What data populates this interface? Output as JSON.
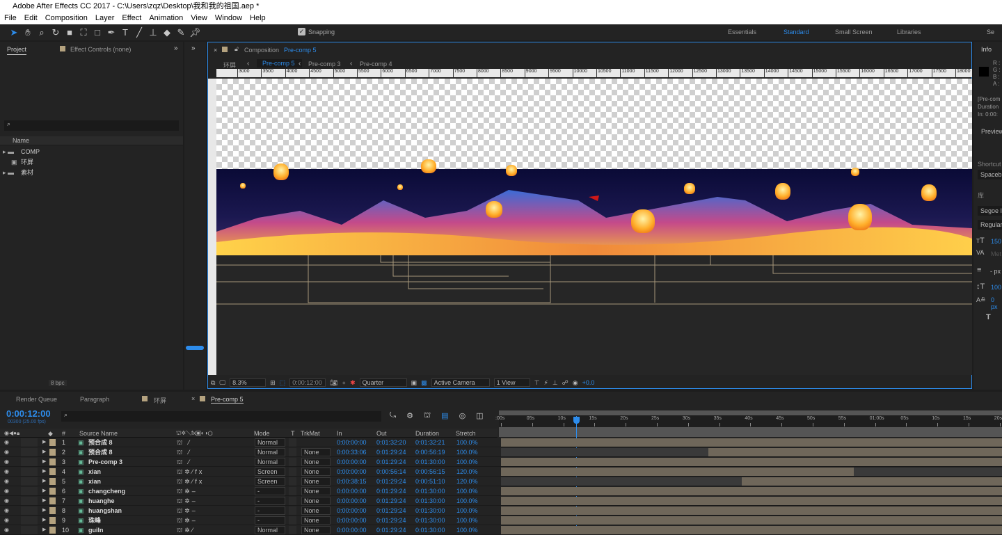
{
  "window": {
    "title": "Adobe After Effects CC 2017 - C:\\Users\\zqz\\Desktop\\我和我的祖国.aep *",
    "logo": "Ae"
  },
  "menu": [
    "File",
    "Edit",
    "Composition",
    "Layer",
    "Effect",
    "Animation",
    "View",
    "Window",
    "Help"
  ],
  "toolbar": {
    "tools": [
      "selection-icon",
      "hand-icon",
      "zoom-icon",
      "rotate-icon",
      "camera-icon",
      "pan-behind-icon",
      "rectangle-icon",
      "pen-icon",
      "type-icon",
      "brush-icon",
      "clone-stamp-icon",
      "eraser-icon",
      "roto-brush-icon",
      "puppet-pin-icon"
    ],
    "snapping": "Snapping",
    "workspaces": [
      "Essentials",
      "Standard",
      "Small Screen",
      "Libraries"
    ],
    "active_workspace": "Standard",
    "search": "Se"
  },
  "project": {
    "tab": "Project",
    "effect_tab": "Effect Controls (none)",
    "column_name": "Name",
    "items": [
      {
        "name": "COMP",
        "type": "folder"
      },
      {
        "name": "环屏",
        "type": "comp"
      },
      {
        "name": "素材",
        "type": "folder"
      }
    ],
    "bpc": "8 bpc"
  },
  "composition": {
    "tab_prefix": "Composition",
    "tab_name": "Pre-comp 5",
    "breadcrumbs": [
      "环屏",
      "Pre-comp 5",
      "Pre-comp 3",
      "Pre-comp 4"
    ],
    "active_breadcrumb": "Pre-comp 5",
    "ruler": [
      "3000",
      "3500",
      "4000",
      "4500",
      "5000",
      "5500",
      "6000",
      "6500",
      "7000",
      "7500",
      "8000",
      "8500",
      "9000",
      "9500",
      "10000",
      "10500",
      "11000",
      "11500",
      "12000",
      "12500",
      "13000",
      "13500",
      "14000",
      "14500",
      "15000",
      "15500",
      "16000",
      "16500",
      "17000",
      "17500",
      "18000"
    ],
    "zoom": "8.3%",
    "timecode": "0:00:12:00",
    "resolution": "Quarter",
    "camera": "Active Camera",
    "views": "1 View",
    "exposure": "+0.0"
  },
  "info": {
    "tab": "Info",
    "channels": [
      "R :",
      "G :",
      "B :",
      "A :"
    ],
    "lines": [
      "[Pre-com",
      "Duration",
      "In: 0:00:"
    ],
    "preview": "Preview",
    "shortcut": "Shortcut",
    "shortcut_value": "Spaceb",
    "library": "库",
    "font": "Segoe I",
    "style": "Regular",
    "size": "150",
    "kerning": "Met",
    "stroke": "- px",
    "leading": "100",
    "baseline": "0 px"
  },
  "bottom_tabs": {
    "render_queue": "Render Queue",
    "paragraph": "Paragraph",
    "comp1": "环屏",
    "comp2": "Pre-comp 5"
  },
  "timeline": {
    "timecode": "0:00:12:00",
    "frames": "00300 (25.00 fps)",
    "headers": {
      "source": "Source Name",
      "mode": "Mode",
      "t": "T",
      "trkmat": "TrkMat",
      "in": "In",
      "out": "Out",
      "duration": "Duration",
      "stretch": "Stretch",
      "num": "#"
    },
    "ticks": [
      ":00s",
      "05s",
      "10s",
      "15s",
      "20s",
      "25s",
      "30s",
      "35s",
      "40s",
      "45s",
      "50s",
      "55s",
      "01:00s",
      "05s",
      "10s",
      "15s",
      "20s"
    ],
    "playhead_seconds": 12,
    "layers": [
      {
        "n": "1",
        "name": "预合成 8",
        "mode": "Normal",
        "trkmat": "",
        "in": "0:00:00:00",
        "out": "0:01:32:20",
        "dur": "0:01:32:21",
        "stretch": "100.0%",
        "fx": false,
        "start": 0,
        "end": null
      },
      {
        "n": "2",
        "name": "预合成 8",
        "mode": "Normal",
        "trkmat": "None",
        "in": "0:00:33:06",
        "out": "0:01:29:24",
        "dur": "0:00:56:19",
        "stretch": "100.0%",
        "fx": false,
        "start": 33.24,
        "end": null
      },
      {
        "n": "3",
        "name": "Pre-comp 3",
        "mode": "Normal",
        "trkmat": "None",
        "in": "0:00:00:00",
        "out": "0:01:29:24",
        "dur": "0:01:30:00",
        "stretch": "100.0%",
        "fx": false,
        "start": 0,
        "end": null
      },
      {
        "n": "4",
        "name": "xian",
        "mode": "Screen",
        "trkmat": "None",
        "in": "0:00:00:00",
        "out": "0:00:56:14",
        "dur": "0:00:56:15",
        "stretch": "120.0%",
        "fx": true,
        "start": 0,
        "end": 56.56
      },
      {
        "n": "5",
        "name": "xian",
        "mode": "Screen",
        "trkmat": "None",
        "in": "0:00:38:15",
        "out": "0:01:29:24",
        "dur": "0:00:51:10",
        "stretch": "120.0%",
        "fx": true,
        "start": 38.6,
        "end": null
      },
      {
        "n": "6",
        "name": "changcheng",
        "mode": "-",
        "trkmat": "None",
        "in": "0:00:00:00",
        "out": "0:01:29:24",
        "dur": "0:01:30:00",
        "stretch": "100.0%",
        "fx": false,
        "start": 0,
        "end": null
      },
      {
        "n": "7",
        "name": "huanghe",
        "mode": "-",
        "trkmat": "None",
        "in": "0:00:00:00",
        "out": "0:01:29:24",
        "dur": "0:01:30:00",
        "stretch": "100.0%",
        "fx": false,
        "start": 0,
        "end": null
      },
      {
        "n": "8",
        "name": "huangshan",
        "mode": "-",
        "trkmat": "None",
        "in": "0:00:00:00",
        "out": "0:01:29:24",
        "dur": "0:01:30:00",
        "stretch": "100.0%",
        "fx": false,
        "start": 0,
        "end": null
      },
      {
        "n": "9",
        "name": "珠峰",
        "mode": "-",
        "trkmat": "None",
        "in": "0:00:00:00",
        "out": "0:01:29:24",
        "dur": "0:01:30:00",
        "stretch": "100.0%",
        "fx": false,
        "start": 0,
        "end": null
      },
      {
        "n": "10",
        "name": "guiln",
        "mode": "Normal",
        "trkmat": "None",
        "in": "0:00:00:00",
        "out": "0:01:29:24",
        "dur": "0:01:30:00",
        "stretch": "100.0%",
        "fx": false,
        "start": 0,
        "end": null
      }
    ]
  },
  "colors": {
    "accent": "#2d8ceb",
    "label": "#b4a27f",
    "bar": "#6f675a"
  }
}
